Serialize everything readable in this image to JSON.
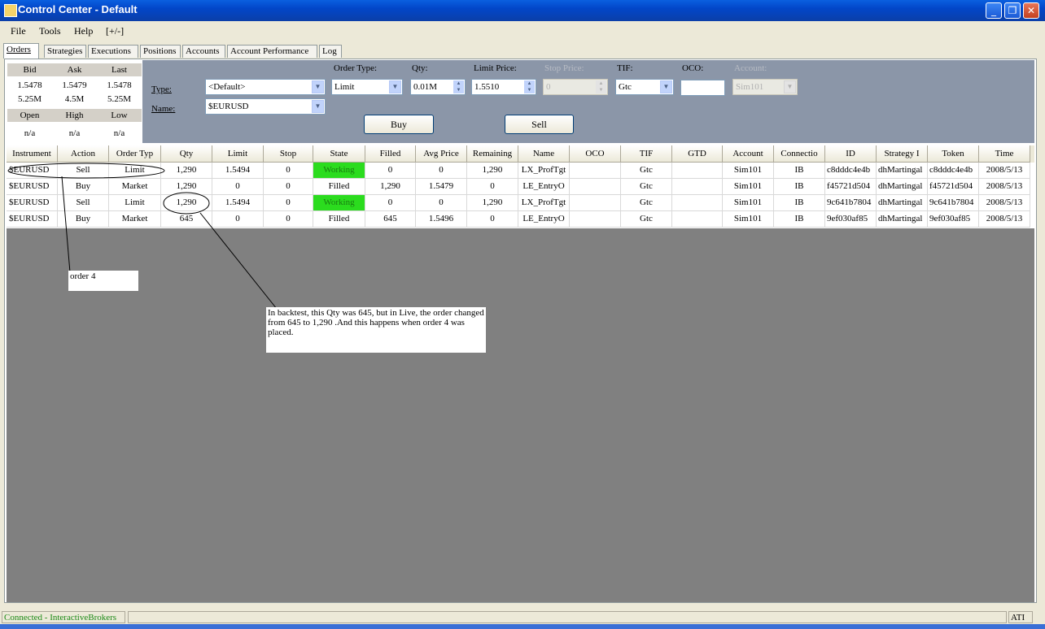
{
  "window": {
    "title": "Control Center - Default",
    "minimize": "_",
    "maximize": "❐",
    "close": "✕"
  },
  "menu": [
    "File",
    "Tools",
    "Help",
    "[+/-]"
  ],
  "tabs": [
    "Orders",
    "Strategies",
    "Executions",
    "Positions",
    "Accounts",
    "Account Performance",
    "Log"
  ],
  "quote": {
    "headers1": [
      "Bid",
      "Ask",
      "Last"
    ],
    "prices": [
      "1.5478",
      "1.5479",
      "1.5478"
    ],
    "sizes": [
      "5.25M",
      "4.5M",
      "5.25M"
    ],
    "headers2": [
      "Open",
      "High",
      "Low"
    ],
    "values2": [
      "n/a",
      "n/a",
      "n/a"
    ]
  },
  "order_entry": {
    "type_label": "Type:",
    "type_value": "<Default>",
    "name_label": "Name:",
    "name_value": "$EURUSD",
    "order_type_label": "Order Type:",
    "order_type_value": "Limit",
    "qty_label": "Qty:",
    "qty_value": "0.01M",
    "limit_price_label": "Limit Price:",
    "limit_price_value": "1.5510",
    "stop_price_label": "Stop Price:",
    "stop_price_value": "0",
    "tif_label": "TIF:",
    "tif_value": "Gtc",
    "oco_label": "OCO:",
    "oco_value": "",
    "account_label": "Account:",
    "account_value": "Sim101",
    "buy_label": "Buy",
    "sell_label": "Sell"
  },
  "orders_table": {
    "columns": [
      "Instrument",
      "Action",
      "Order Typ",
      "Qty",
      "Limit",
      "Stop",
      "State",
      "Filled",
      "Avg Price",
      "Remaining",
      "Name",
      "OCO",
      "TIF",
      "GTD",
      "Account",
      "Connectio",
      "ID",
      "Strategy I",
      "Token",
      "Time"
    ],
    "rows": [
      [
        "$EURUSD",
        "Sell",
        "Limit",
        "1,290",
        "1.5494",
        "0",
        "Working",
        "0",
        "0",
        "1,290",
        "LX_ProfTgt",
        "",
        "Gtc",
        "",
        "Sim101",
        "IB",
        "c8dddc4e4b",
        "dhMartingal",
        "c8dddc4e4b",
        "2008/5/13"
      ],
      [
        "$EURUSD",
        "Buy",
        "Market",
        "1,290",
        "0",
        "0",
        "Filled",
        "1,290",
        "1.5479",
        "0",
        "LE_EntryO",
        "",
        "Gtc",
        "",
        "Sim101",
        "IB",
        "f45721d504",
        "dhMartingal",
        "f45721d504",
        "2008/5/13"
      ],
      [
        "$EURUSD",
        "Sell",
        "Limit",
        "1,290",
        "1.5494",
        "0",
        "Working",
        "0",
        "0",
        "1,290",
        "LX_ProfTgt",
        "",
        "Gtc",
        "",
        "Sim101",
        "IB",
        "9c641b7804",
        "dhMartingal",
        "9c641b7804",
        "2008/5/13"
      ],
      [
        "$EURUSD",
        "Buy",
        "Market",
        "645",
        "0",
        "0",
        "Filled",
        "645",
        "1.5496",
        "0",
        "LE_EntryO",
        "",
        "Gtc",
        "",
        "Sim101",
        "IB",
        "9ef030af85",
        "dhMartingal",
        "9ef030af85",
        "2008/5/13"
      ]
    ]
  },
  "annotations": {
    "note1": "order 4",
    "note2": "In backtest, this Qty was 645, but in Live, the order changed from 645 to 1,290 .And this happens when order 4 was placed."
  },
  "status": {
    "connection": "Connected - InteractiveBrokers",
    "right": "ATI"
  },
  "colors": {
    "working": "#2bdc1e",
    "title_bar": "#0246c8",
    "entry_panel": "#8b96a8",
    "workspace": "#808080"
  }
}
